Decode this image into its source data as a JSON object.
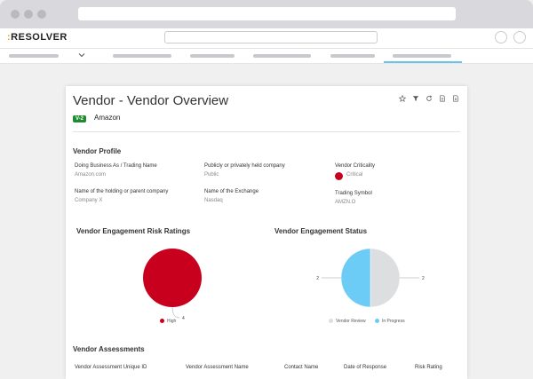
{
  "app": {
    "brand_prefix": ":",
    "brand": "RESOLVER"
  },
  "page": {
    "title": "Vendor - Vendor Overview",
    "badge": "V-2",
    "vendor_name": "Amazon"
  },
  "profile": {
    "heading": "Vendor Profile",
    "fields": {
      "dba_label": "Doing Business As / Trading Name",
      "dba_value": "Amazon.com",
      "public_label": "Publicly or privately held company",
      "public_value": "Public",
      "criticality_label": "Vendor Criticality",
      "criticality_value": "Critical",
      "holding_label": "Name of the holding or parent company",
      "holding_value": "Company X",
      "exchange_label": "Name of the Exchange",
      "exchange_value": "Nasdaq",
      "symbol_label": "Trading Symbol",
      "symbol_value": "AMZN.O"
    },
    "criticality_color": "#c8001e"
  },
  "charts": {
    "risk_title": "Vendor Engagement Risk Ratings",
    "status_title": "Vendor Engagement Status"
  },
  "chart_data": [
    {
      "type": "pie",
      "title": "Vendor Engagement Risk Ratings",
      "slices": [
        {
          "label": "High",
          "value": 4,
          "color": "#c8001e"
        }
      ],
      "legend": "bottom"
    },
    {
      "type": "pie",
      "title": "Vendor Engagement Status",
      "slices": [
        {
          "label": "Vendor Review",
          "value": 2,
          "color": "#dcdee0"
        },
        {
          "label": "In Progress",
          "value": 2,
          "color": "#6cccf5"
        }
      ],
      "legend": "bottom"
    }
  ],
  "assessments": {
    "heading": "Vendor Assessments",
    "columns": [
      "Vendor Assessment Unique ID",
      "Vendor Assessment Name",
      "Contact Name",
      "Date of Response",
      "Risk Rating"
    ]
  },
  "icons": [
    "star-icon",
    "filter-icon",
    "refresh-icon",
    "document-icon",
    "export-icon",
    "chevron-down-icon"
  ]
}
